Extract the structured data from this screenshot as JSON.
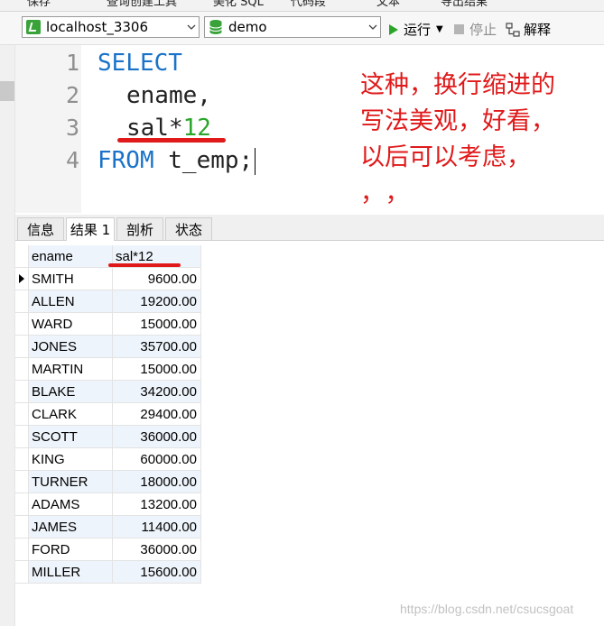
{
  "top_toolbar": {
    "items": [
      "保存",
      "查询创建工具",
      "美化 SQL",
      "代码段",
      "文本",
      "导出结果"
    ]
  },
  "connection_bar": {
    "connection": "localhost_3306",
    "database": "demo",
    "run_label": "运行",
    "stop_label": "停止",
    "explain_label": "解释"
  },
  "editor": {
    "line_numbers": [
      "1",
      "2",
      "3",
      "4"
    ],
    "sql": {
      "select_kw": "SELECT",
      "col1": "ename,",
      "col2_name": "sal*",
      "col2_num": "12",
      "from_kw": "FROM",
      "table": " t_emp;"
    }
  },
  "annotation": {
    "line1": "这种，换行缩进的",
    "line2": "写法美观，好看，",
    "line3": "以后可以考虑，",
    "line4": "，，"
  },
  "result_tabs": [
    "信息",
    "结果 1",
    "剖析",
    "状态"
  ],
  "active_tab_index": 1,
  "grid": {
    "columns": [
      "ename",
      "sal*12"
    ],
    "rows": [
      [
        "SMITH",
        "9600.00"
      ],
      [
        "ALLEN",
        "19200.00"
      ],
      [
        "WARD",
        "15000.00"
      ],
      [
        "JONES",
        "35700.00"
      ],
      [
        "MARTIN",
        "15000.00"
      ],
      [
        "BLAKE",
        "34200.00"
      ],
      [
        "CLARK",
        "29400.00"
      ],
      [
        "SCOTT",
        "36000.00"
      ],
      [
        "KING",
        "60000.00"
      ],
      [
        "TURNER",
        "18000.00"
      ],
      [
        "ADAMS",
        "13200.00"
      ],
      [
        "JAMES",
        "11400.00"
      ],
      [
        "FORD",
        "36000.00"
      ],
      [
        "MILLER",
        "15600.00"
      ]
    ],
    "selected_row": 0
  },
  "watermark": "https://blog.csdn.net/csucsgoat",
  "colors": {
    "annotation_red": "#e0191a",
    "keyword_blue": "#1a73c9",
    "number_green": "#2aa52a",
    "row_highlight": "#eef4fb"
  }
}
